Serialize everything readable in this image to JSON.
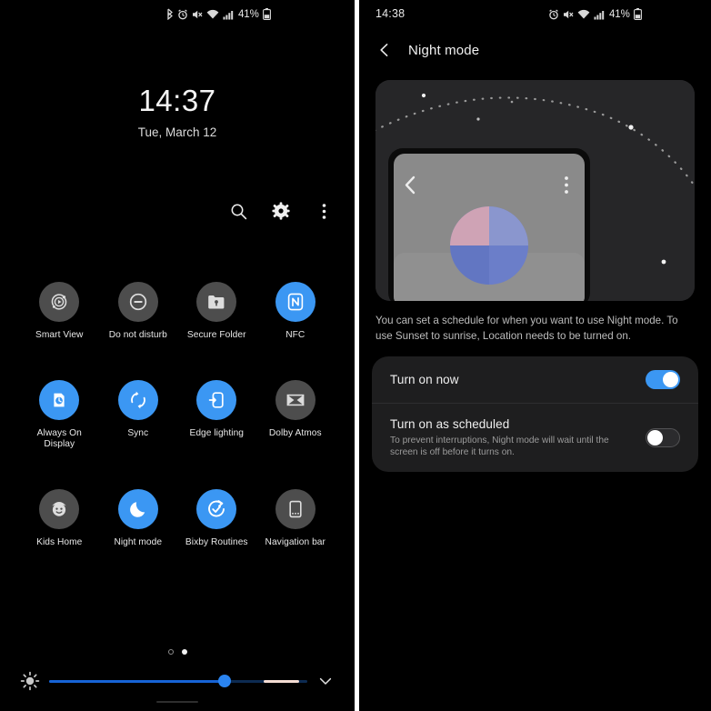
{
  "colors": {
    "accent_blue": "#3b97f3",
    "tile_off_gray": "#4d4d4d",
    "moon_yellow": "#F5C518",
    "card_bg": "#1e1e1f",
    "illustration_bg": "#262628",
    "slider_fill": "#1663d6",
    "slider_alt": "#f5ddd4"
  },
  "quick_settings": {
    "status_bar": {
      "battery_percent": "41%",
      "icons": [
        "bluetooth-icon",
        "alarm-icon",
        "mute-icon",
        "wifi-icon",
        "signal-icon",
        "battery-icon"
      ]
    },
    "clock": {
      "time": "14:37",
      "date": "Tue, March 12"
    },
    "actions": [
      {
        "name": "search-icon",
        "label": "Search"
      },
      {
        "name": "gear-icon",
        "label": "Settings"
      },
      {
        "name": "overflow-menu-icon",
        "label": "More options"
      }
    ],
    "tiles": [
      [
        {
          "label": "Smart View",
          "icon": "smart-view-icon",
          "state": "off"
        },
        {
          "label": "Do not disturb",
          "icon": "do-not-disturb-icon",
          "state": "off"
        },
        {
          "label": "Secure Folder",
          "icon": "secure-folder-icon",
          "state": "off"
        },
        {
          "label": "NFC",
          "icon": "nfc-icon",
          "state": "on"
        }
      ],
      [
        {
          "label": "Always On Display",
          "icon": "always-on-display-icon",
          "state": "on"
        },
        {
          "label": "Sync",
          "icon": "sync-icon",
          "state": "on"
        },
        {
          "label": "Edge lighting",
          "icon": "edge-lighting-icon",
          "state": "on"
        },
        {
          "label": "Dolby Atmos",
          "icon": "dolby-atmos-icon",
          "state": "off"
        }
      ],
      [
        {
          "label": "Kids Home",
          "icon": "kids-home-icon",
          "state": "off"
        },
        {
          "label": "Night mode",
          "icon": "night-mode-icon",
          "state": "on"
        },
        {
          "label": "Bixby Routines",
          "icon": "bixby-routines-icon",
          "state": "on"
        },
        {
          "label": "Navigation bar",
          "icon": "navigation-bar-icon",
          "state": "off"
        }
      ]
    ],
    "page_indicator": {
      "total": 2,
      "active_index": 1
    },
    "brightness": {
      "value_percent": 68,
      "icon": "brightness-icon",
      "expand_icon": "chevron-down-icon"
    }
  },
  "night_mode": {
    "status_bar": {
      "time": "14:38",
      "battery_percent": "41%",
      "icons": [
        "alarm-icon",
        "mute-icon",
        "wifi-icon",
        "signal-icon",
        "battery-icon"
      ]
    },
    "appbar": {
      "back_icon": "back-chevron-icon",
      "title": "Night mode"
    },
    "illustration": {
      "moon_icon": "crescent-moon-icon",
      "phone_mockup_back_icon": "back-chevron-icon",
      "phone_mockup_menu_icon": "overflow-menu-icon"
    },
    "description": "You can set a schedule for when you want to use Night mode. To use Sunset to sunrise, Location needs to be turned on.",
    "rows": [
      {
        "title": "Turn on now",
        "subtitle": "",
        "toggle": "on"
      },
      {
        "title": "Turn on as scheduled",
        "subtitle": "To prevent interruptions, Night mode will wait until the screen is off before it turns on.",
        "toggle": "off"
      }
    ]
  }
}
